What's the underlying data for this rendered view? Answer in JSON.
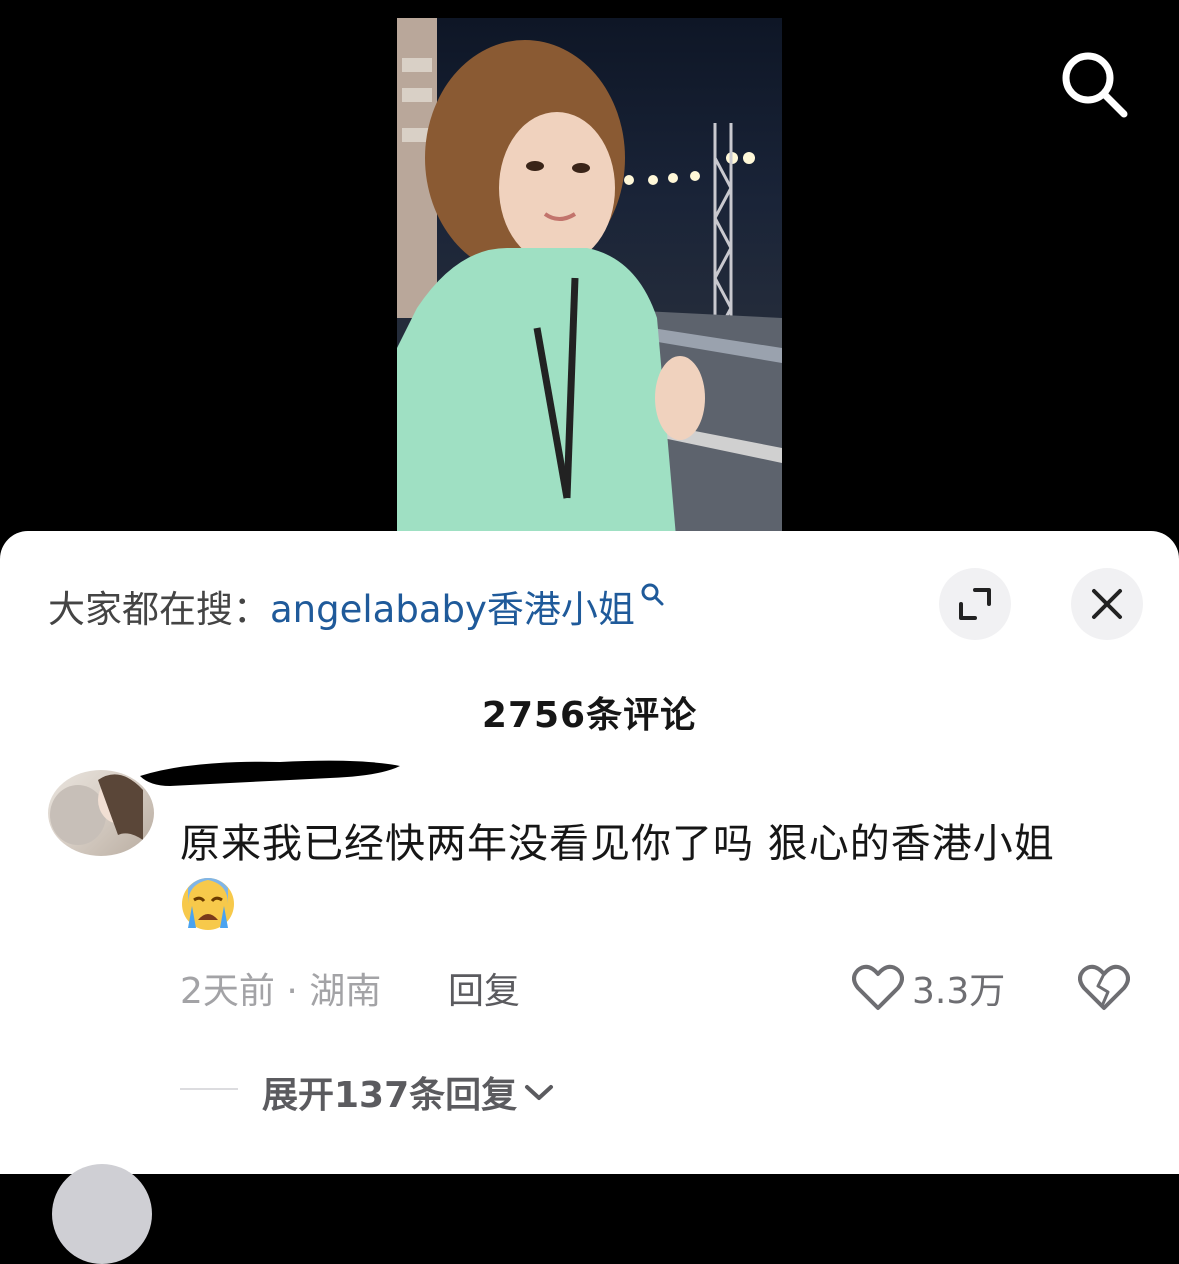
{
  "header": {
    "search_icon": "search-icon"
  },
  "sheet": {
    "search_hint": {
      "prefix": "大家都在搜：",
      "term": "angelababy香港小姐"
    },
    "expand_icon": "expand-icon",
    "close_icon": "close-icon",
    "comment_count": "2756条评论"
  },
  "comment": {
    "text": "原来我已经快两年没看见你了吗 狠心的香港小姐",
    "emoji": "crying-face-icon",
    "meta": "2天前 · 湖南",
    "reply_label": "回复",
    "like_count": "3.3万",
    "expand_replies_label": "展开137条回复"
  }
}
